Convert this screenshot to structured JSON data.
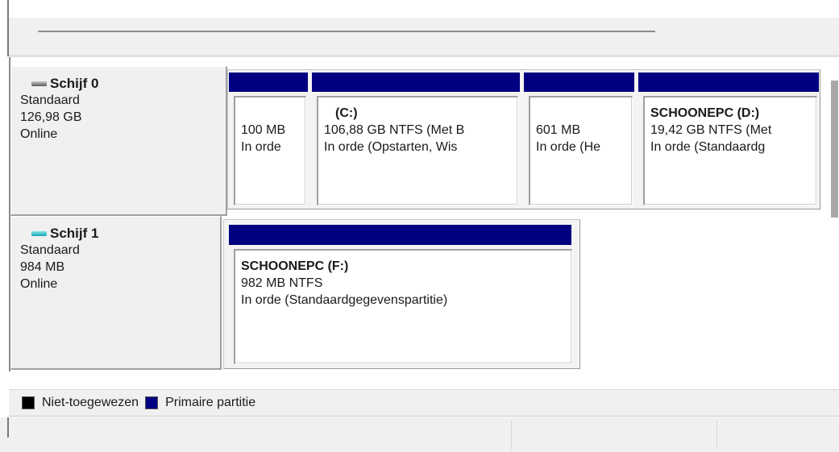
{
  "colors": {
    "primary_partition": "#000080",
    "unallocated": "#000000"
  },
  "disks": [
    {
      "name": "Schijf 0",
      "icon": "hard-disk-icon",
      "type": "Standaard",
      "size": "126,98 GB",
      "status": "Online",
      "partitions": [
        {
          "title": "",
          "line1": "100 MB",
          "line2": "In orde"
        },
        {
          "title": "(C:)",
          "line1": "106,88 GB NTFS (Met B",
          "line2": "In orde (Opstarten, Wis"
        },
        {
          "title": "",
          "line1": "601 MB",
          "line2": "In orde (He"
        },
        {
          "title": "SCHOONEPC  (D:)",
          "line1": "19,42 GB NTFS (Met",
          "line2": "In orde (Standaardg"
        }
      ]
    },
    {
      "name": "Schijf 1",
      "icon": "removable-disk-icon",
      "type": "Standaard",
      "size": "984 MB",
      "status": "Online",
      "partitions": [
        {
          "title": "SCHOONEPC  (F:)",
          "line1": "982 MB NTFS",
          "line2": "In orde (Standaardgegevenspartitie)"
        }
      ]
    }
  ],
  "legend": {
    "unallocated_label": "Niet-toegewezen",
    "primary_label": "Primaire partitie"
  }
}
